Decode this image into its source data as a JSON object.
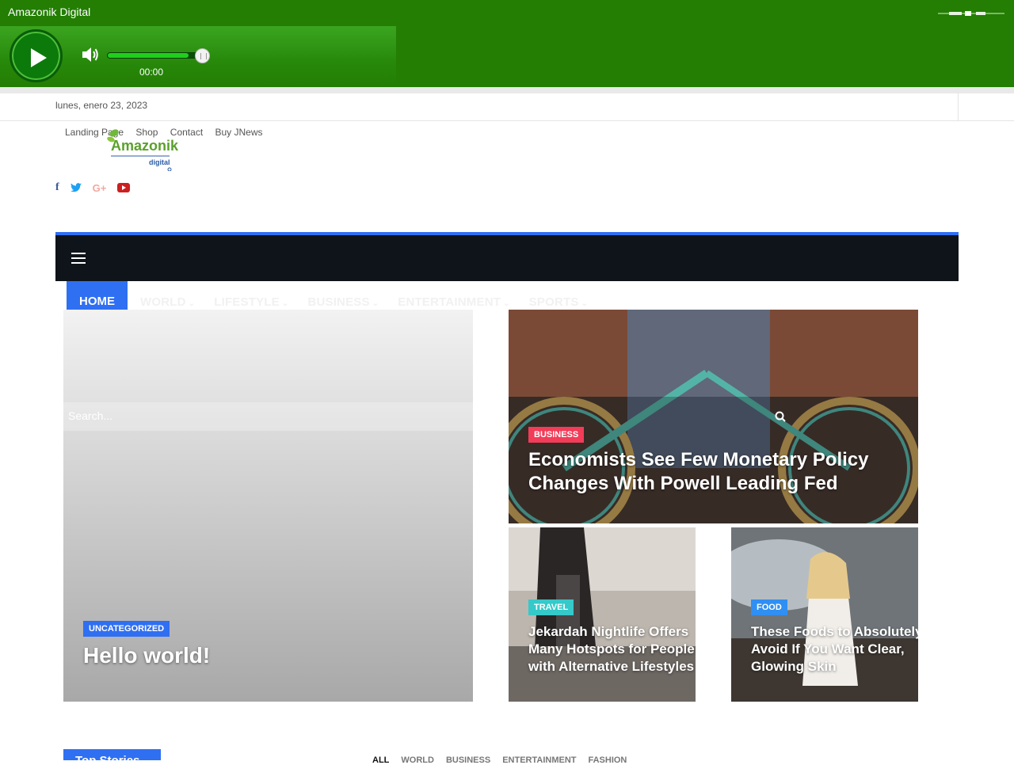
{
  "player": {
    "station_name": "Amazonik Digital",
    "time": "00:00",
    "volume_level": 0.85,
    "icons": [
      "play-icon",
      "volume-icon",
      "waveform-icon"
    ]
  },
  "topbar": {
    "date": "lunes, enero 23, 2023"
  },
  "top_nav": {
    "items": [
      "Landing Page",
      "Shop",
      "Contact",
      "Buy JNews"
    ]
  },
  "logo": {
    "text": "Amazonik",
    "subtext": "digital"
  },
  "social": {
    "items": [
      {
        "name": "facebook-icon",
        "glyph": "f",
        "color": "#3b5998"
      },
      {
        "name": "twitter-icon",
        "glyph": "t",
        "color": "#1da1f2"
      },
      {
        "name": "google-plus-icon",
        "glyph": "G+",
        "color": "#f3a8a0"
      },
      {
        "name": "youtube-icon",
        "glyph": "▶",
        "color": "#cc1f1f"
      }
    ]
  },
  "main_nav": {
    "home": "HOME",
    "items": [
      "WORLD",
      "LIFESTYLE",
      "BUSINESS",
      "ENTERTAINMENT",
      "SPORTS"
    ],
    "accent_color": "#2f6ff2"
  },
  "search": {
    "placeholder": "Search..."
  },
  "featured": {
    "main": {
      "category": "UNCATEGORIZED",
      "title": "Hello world!",
      "category_color": "#2f6ff2"
    },
    "top_right": {
      "category": "BUSINESS",
      "title": "Economists See Few Monetary Policy Changes With Powell Leading Fed",
      "category_color": "#f23c58"
    },
    "bottom_left": {
      "category": "TRAVEL",
      "title": "Jekardah Nightlife Offers Many Hotspots for People with Alternative Lifestyles",
      "category_color": "#35c9c9"
    },
    "bottom_right": {
      "category": "FOOD",
      "title": "These Foods to Absolutely Avoid If You Want Clear, Glowing Skin",
      "category_color": "#2f8ff2"
    }
  },
  "section": {
    "title": "Top Stories",
    "filters": [
      "ALL",
      "WORLD",
      "BUSINESS",
      "ENTERTAINMENT",
      "FASHION"
    ]
  }
}
